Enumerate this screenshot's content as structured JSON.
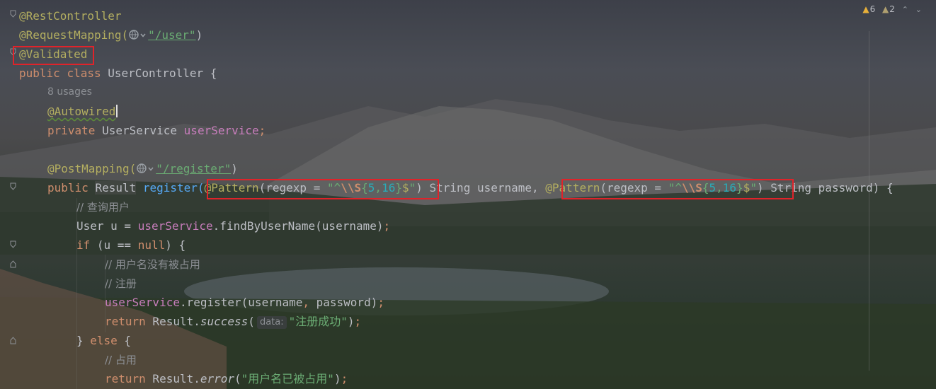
{
  "inspections": {
    "warnings": "6",
    "weak_warnings": "2",
    "nav_up": "⌃",
    "nav_down": "⌄"
  },
  "code": {
    "l1": "@RestController",
    "l2_ann": "@RequestMapping(",
    "l2_str": "\"/user\"",
    "l2_close": ")",
    "l3": "@Validated",
    "l4_kw1": "public",
    "l4_kw2": "class",
    "l4_rest": " UserController {",
    "usages": "8 usages",
    "l5": "@Autowired",
    "l6_kw": "private",
    "l6_type": " UserService ",
    "l6_field": "userService",
    "l6_semi": ";",
    "l8_ann": "@PostMapping(",
    "l8_str": "\"/register\"",
    "l8_close": ")",
    "l9_kw": "public",
    "l9_type": "Result",
    "l9_method": " register(",
    "pattern_ann": "@Pattern",
    "pattern_open": "(regexp = ",
    "pattern_q1": "\"",
    "pattern_caret": "^",
    "pattern_esc": "\\\\S",
    "pattern_brace_open": "{",
    "pattern_num1": "5",
    "pattern_comma": ",",
    "pattern_num2": "16",
    "pattern_brace_close": "}",
    "pattern_dollar": "$",
    "pattern_q2": "\"",
    "pattern_close": ")",
    "l9_param1": " String username, ",
    "l9_param2": " String password) {",
    "c1": "// 查询用户",
    "l11_a": "User u = ",
    "l11_field": "userService",
    "l11_b": ".findByUserName(username)",
    "l11_semi": ";",
    "l12_kw": "if",
    "l12_a": " (u == ",
    "l12_null": "null",
    "l12_b": ") {",
    "c2": "// 用户名没有被占用",
    "c3": "// 注册",
    "l15_field": "userService",
    "l15_a": ".register(username",
    "l15_comma": ",",
    "l15_b": " password)",
    "l15_semi": ";",
    "l16_kw": "return",
    "l16_a": " Result.",
    "l16_method": "success",
    "l16_open": "(",
    "l16_hint": "data:",
    "l16_str": "\"注册成功\"",
    "l16_close": ")",
    "l16_semi": ";",
    "l17_a": "} ",
    "l17_kw": "else",
    "l17_b": " {",
    "c4": "// 占用",
    "l19_kw": "return",
    "l19_a": " Result.",
    "l19_method": "error",
    "l19_open": "(",
    "l19_str": "\"用户名已被占用\"",
    "l19_close": ")",
    "l19_semi": ";"
  }
}
